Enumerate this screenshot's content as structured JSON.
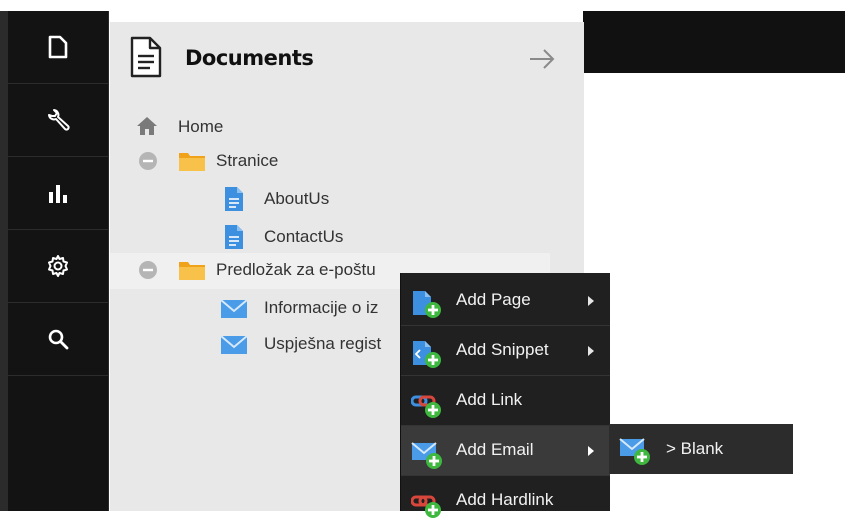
{
  "nav": {
    "items": [
      {
        "name": "documents",
        "icon": "document-icon"
      },
      {
        "name": "settings-tools",
        "icon": "wrench-icon"
      },
      {
        "name": "analytics",
        "icon": "bar-chart-icon"
      },
      {
        "name": "settings",
        "icon": "gear-icon"
      },
      {
        "name": "search",
        "icon": "search-icon"
      }
    ]
  },
  "panel": {
    "title": "Documents",
    "header_icon": "document-icon",
    "close_icon": "arrow-right-icon"
  },
  "tree": {
    "home": "Home",
    "stranice": "Stranice",
    "about": "AboutUs",
    "contact": "ContactUs",
    "email_template": "Predložak za e-poštu",
    "info": "Informacije o iz",
    "success": "Uspješna regist"
  },
  "context_menu": {
    "add_page": "Add Page",
    "add_snippet": "Add Snippet",
    "add_link": "Add Link",
    "add_email": "Add Email",
    "add_hardlink": "Add Hardlink"
  },
  "submenu": {
    "blank": "> Blank"
  },
  "colors": {
    "nav_bg": "#131313",
    "panel_bg": "#e8e8e8",
    "menu_bg": "#202020",
    "doc_blue": "#4a90e2",
    "folder_orange": "#f5a623",
    "plus_green": "#3fb83f"
  }
}
